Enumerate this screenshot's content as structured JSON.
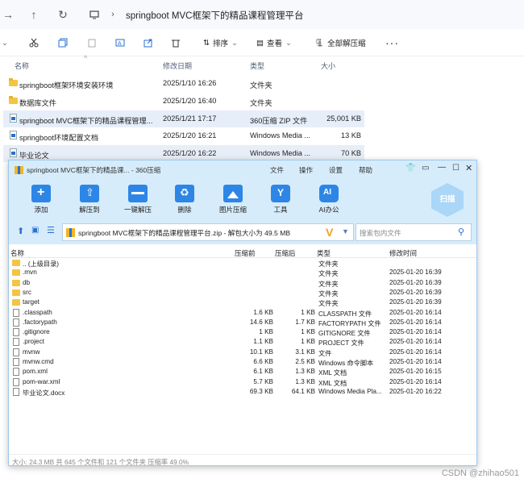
{
  "explorer": {
    "breadcrumb": "springboot MVC框架下的精品课程管理平台",
    "toolbar": {
      "sort": "排序",
      "view": "查看",
      "extract_all": "全部解压缩"
    },
    "columns": {
      "name": "名称",
      "modified": "修改日期",
      "type": "类型",
      "size": "大小"
    },
    "rows": [
      {
        "name": "springboot框架环境安装环境",
        "date": "2025/1/10 16:26",
        "type": "文件夹",
        "size": ""
      },
      {
        "name": "数据库文件",
        "date": "2025/1/20 16:40",
        "type": "文件夹",
        "size": ""
      },
      {
        "name": "springboot MVC框架下的精品课程管理...",
        "date": "2025/1/21 17:17",
        "type": "360压缩 ZIP 文件",
        "size": "25,001 KB"
      },
      {
        "name": "springboot环境配置文档",
        "date": "2025/1/20 16:21",
        "type": "Windows Media ...",
        "size": "13 KB"
      },
      {
        "name": "毕业论文",
        "date": "2025/1/20 16:22",
        "type": "Windows Media ...",
        "size": "70 KB"
      }
    ]
  },
  "zip": {
    "title": "springboot MVC框架下的精品课... - 360压缩",
    "menu": [
      "文件",
      "操作",
      "设置",
      "帮助"
    ],
    "tools": [
      "添加",
      "解压到",
      "一键解压",
      "删除",
      "图片压缩",
      "工具",
      "AI办公"
    ],
    "scan": "扫描",
    "path": "springboot MVC框架下的精品课程管理平台.zip - 解包大小为 49.5 MB",
    "search_placeholder": "搜索包内文件",
    "columns": {
      "name": "名称",
      "before": "压缩前",
      "after": "压缩后",
      "type": "类型",
      "modified": "修改时间"
    },
    "rows": [
      {
        "name": ".. (上级目录)",
        "before": "",
        "after": "",
        "type": "文件夹",
        "date": "",
        "icon": "folder"
      },
      {
        "name": ".mvn",
        "before": "",
        "after": "",
        "type": "文件夹",
        "date": "2025-01-20 16:39",
        "icon": "folder"
      },
      {
        "name": "db",
        "before": "",
        "after": "",
        "type": "文件夹",
        "date": "2025-01-20 16:39",
        "icon": "folder"
      },
      {
        "name": "src",
        "before": "",
        "after": "",
        "type": "文件夹",
        "date": "2025-01-20 16:39",
        "icon": "folder"
      },
      {
        "name": "target",
        "before": "",
        "after": "",
        "type": "文件夹",
        "date": "2025-01-20 16:39",
        "icon": "folder"
      },
      {
        "name": ".classpath",
        "before": "1.6 KB",
        "after": "1 KB",
        "type": "CLASSPATH 文件",
        "date": "2025-01-20 16:14",
        "icon": "file"
      },
      {
        "name": ".factorypath",
        "before": "14.6 KB",
        "after": "1.7 KB",
        "type": "FACTORYPATH 文件",
        "date": "2025-01-20 16:14",
        "icon": "file"
      },
      {
        "name": ".gitignore",
        "before": "1 KB",
        "after": "1 KB",
        "type": "GITIGNORE 文件",
        "date": "2025-01-20 16:14",
        "icon": "file"
      },
      {
        "name": ".project",
        "before": "1.1 KB",
        "after": "1 KB",
        "type": "PROJECT 文件",
        "date": "2025-01-20 16:14",
        "icon": "file"
      },
      {
        "name": "mvnw",
        "before": "10.1 KB",
        "after": "3.1 KB",
        "type": "文件",
        "date": "2025-01-20 16:14",
        "icon": "file"
      },
      {
        "name": "mvnw.cmd",
        "before": "6.6 KB",
        "after": "2.5 KB",
        "type": "Windows 命令脚本",
        "date": "2025-01-20 16:14",
        "icon": "file"
      },
      {
        "name": "pom.xml",
        "before": "6.1 KB",
        "after": "1.3 KB",
        "type": "XML 文档",
        "date": "2025-01-20 16:15",
        "icon": "file"
      },
      {
        "name": "pom-war.xml",
        "before": "5.7 KB",
        "after": "1.3 KB",
        "type": "XML 文档",
        "date": "2025-01-20 16:14",
        "icon": "file"
      },
      {
        "name": "毕业论文.docx",
        "before": "69.3 KB",
        "after": "64.1 KB",
        "type": "Windows Media Pla...",
        "date": "2025-01-20 16:22",
        "icon": "file"
      }
    ],
    "status": "大小: 24.3 MB 共 645 个文件和 121 个文件夹 压缩率 49.0%"
  },
  "watermark": "CSDN @zhihao501"
}
